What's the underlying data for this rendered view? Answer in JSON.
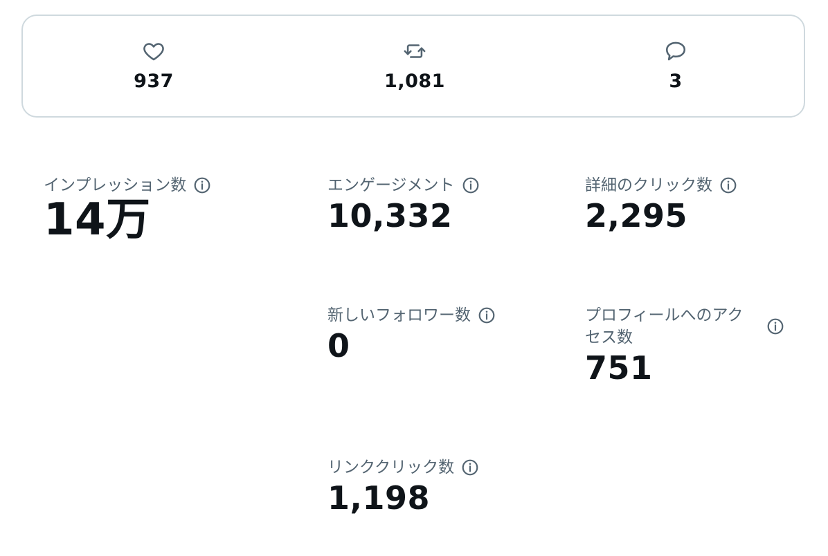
{
  "engagement_bar": {
    "likes": {
      "icon": "heart-icon",
      "value": "937"
    },
    "reposts": {
      "icon": "repost-icon",
      "value": "1,081"
    },
    "replies": {
      "icon": "reply-icon",
      "value": "3"
    }
  },
  "metrics": {
    "impressions": {
      "label": "インプレッション数",
      "value": "14万"
    },
    "engagements": {
      "label": "エンゲージメント",
      "value": "10,332"
    },
    "detail_clicks": {
      "label": "詳細のクリック数",
      "value": "2,295"
    },
    "new_followers": {
      "label": "新しいフォロワー数",
      "value": "0"
    },
    "profile_visits": {
      "label": "プロフィールへのアクセス数",
      "value": "751"
    },
    "link_clicks": {
      "label": "リンククリック数",
      "value": "1,198"
    }
  },
  "colors": {
    "text": "#0f1419",
    "secondary": "#536471",
    "border": "#cfd9de"
  }
}
